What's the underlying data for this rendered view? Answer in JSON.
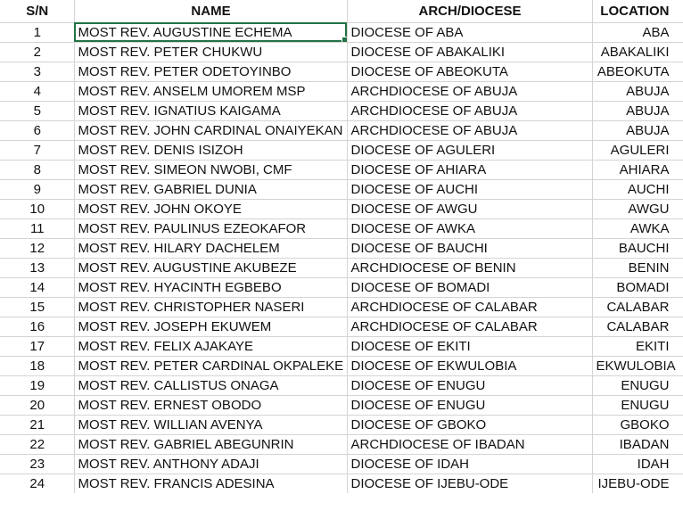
{
  "headers": {
    "sn": "S/N",
    "name": "NAME",
    "arch": "ARCH/DIOCESE",
    "location": "LOCATION"
  },
  "rows": [
    {
      "sn": "1",
      "name": "MOST REV. AUGUSTINE ECHEMA",
      "arch": "DIOCESE OF ABA",
      "location": "ABA"
    },
    {
      "sn": "2",
      "name": "MOST REV. PETER CHUKWU",
      "arch": "DIOCESE OF ABAKALIKI",
      "location": "ABAKALIKI"
    },
    {
      "sn": "3",
      "name": "MOST REV. PETER ODETOYINBO",
      "arch": "DIOCESE OF ABEOKUTA",
      "location": "ABEOKUTA"
    },
    {
      "sn": "4",
      "name": "MOST REV. ANSELM UMOREM MSP",
      "arch": "ARCHDIOCESE OF ABUJA",
      "location": "ABUJA"
    },
    {
      "sn": "5",
      "name": "MOST REV. IGNATIUS KAIGAMA",
      "arch": "ARCHDIOCESE OF ABUJA",
      "location": "ABUJA"
    },
    {
      "sn": "6",
      "name": "MOST REV. JOHN CARDINAL ONAIYEKAN",
      "arch": "ARCHDIOCESE OF ABUJA",
      "location": "ABUJA"
    },
    {
      "sn": "7",
      "name": "MOST REV. DENIS ISIZOH",
      "arch": "DIOCESE OF AGULERI",
      "location": "AGULERI"
    },
    {
      "sn": "8",
      "name": "MOST REV. SIMEON NWOBI, CMF",
      "arch": "DIOCESE OF AHIARA",
      "location": "AHIARA"
    },
    {
      "sn": "9",
      "name": "MOST REV. GABRIEL DUNIA",
      "arch": "DIOCESE OF AUCHI",
      "location": "AUCHI"
    },
    {
      "sn": "10",
      "name": "MOST REV. JOHN OKOYE",
      "arch": "DIOCESE OF AWGU",
      "location": "AWGU"
    },
    {
      "sn": "11",
      "name": "MOST REV. PAULINUS EZEOKAFOR",
      "arch": "DIOCESE OF AWKA",
      "location": "AWKA"
    },
    {
      "sn": "12",
      "name": "MOST REV. HILARY DACHELEM",
      "arch": "DIOCESE OF BAUCHI",
      "location": "BAUCHI"
    },
    {
      "sn": "13",
      "name": "MOST REV. AUGUSTINE AKUBEZE",
      "arch": "ARCHDIOCESE OF BENIN",
      "location": "BENIN"
    },
    {
      "sn": "14",
      "name": "MOST REV. HYACINTH EGBEBO",
      "arch": "DIOCESE OF BOMADI",
      "location": "BOMADI"
    },
    {
      "sn": "15",
      "name": "MOST REV. CHRISTOPHER NASERI",
      "arch": "ARCHDIOCESE OF CALABAR",
      "location": "CALABAR"
    },
    {
      "sn": "16",
      "name": "MOST REV. JOSEPH EKUWEM",
      "arch": "ARCHDIOCESE OF CALABAR",
      "location": "CALABAR"
    },
    {
      "sn": "17",
      "name": "MOST REV. FELIX AJAKAYE",
      "arch": "DIOCESE OF EKITI",
      "location": "EKITI"
    },
    {
      "sn": "18",
      "name": "MOST REV. PETER CARDINAL OKPALEKE",
      "arch": "DIOCESE OF EKWULOBIA",
      "location": "EKWULOBIA"
    },
    {
      "sn": "19",
      "name": "MOST REV. CALLISTUS ONAGA",
      "arch": "DIOCESE OF ENUGU",
      "location": "ENUGU"
    },
    {
      "sn": "20",
      "name": "MOST REV. ERNEST OBODO",
      "arch": "DIOCESE OF ENUGU",
      "location": "ENUGU"
    },
    {
      "sn": "21",
      "name": "MOST REV. WILLIAN AVENYA",
      "arch": "DIOCESE OF GBOKO",
      "location": "GBOKO"
    },
    {
      "sn": "22",
      "name": "MOST REV. GABRIEL ABEGUNRIN",
      "arch": "ARCHDIOCESE OF IBADAN",
      "location": "IBADAN"
    },
    {
      "sn": "23",
      "name": "MOST REV. ANTHONY ADAJI",
      "arch": "DIOCESE OF IDAH",
      "location": "IDAH"
    },
    {
      "sn": "24",
      "name": "MOST REV. FRANCIS ADESINA",
      "arch": "DIOCESE OF IJEBU-ODE",
      "location": "IJEBU-ODE"
    }
  ],
  "selection": {
    "row": 1,
    "column": "name"
  },
  "colors": {
    "gridline": "#d4d4d4",
    "selection_border": "#217346",
    "text": "#111111"
  }
}
